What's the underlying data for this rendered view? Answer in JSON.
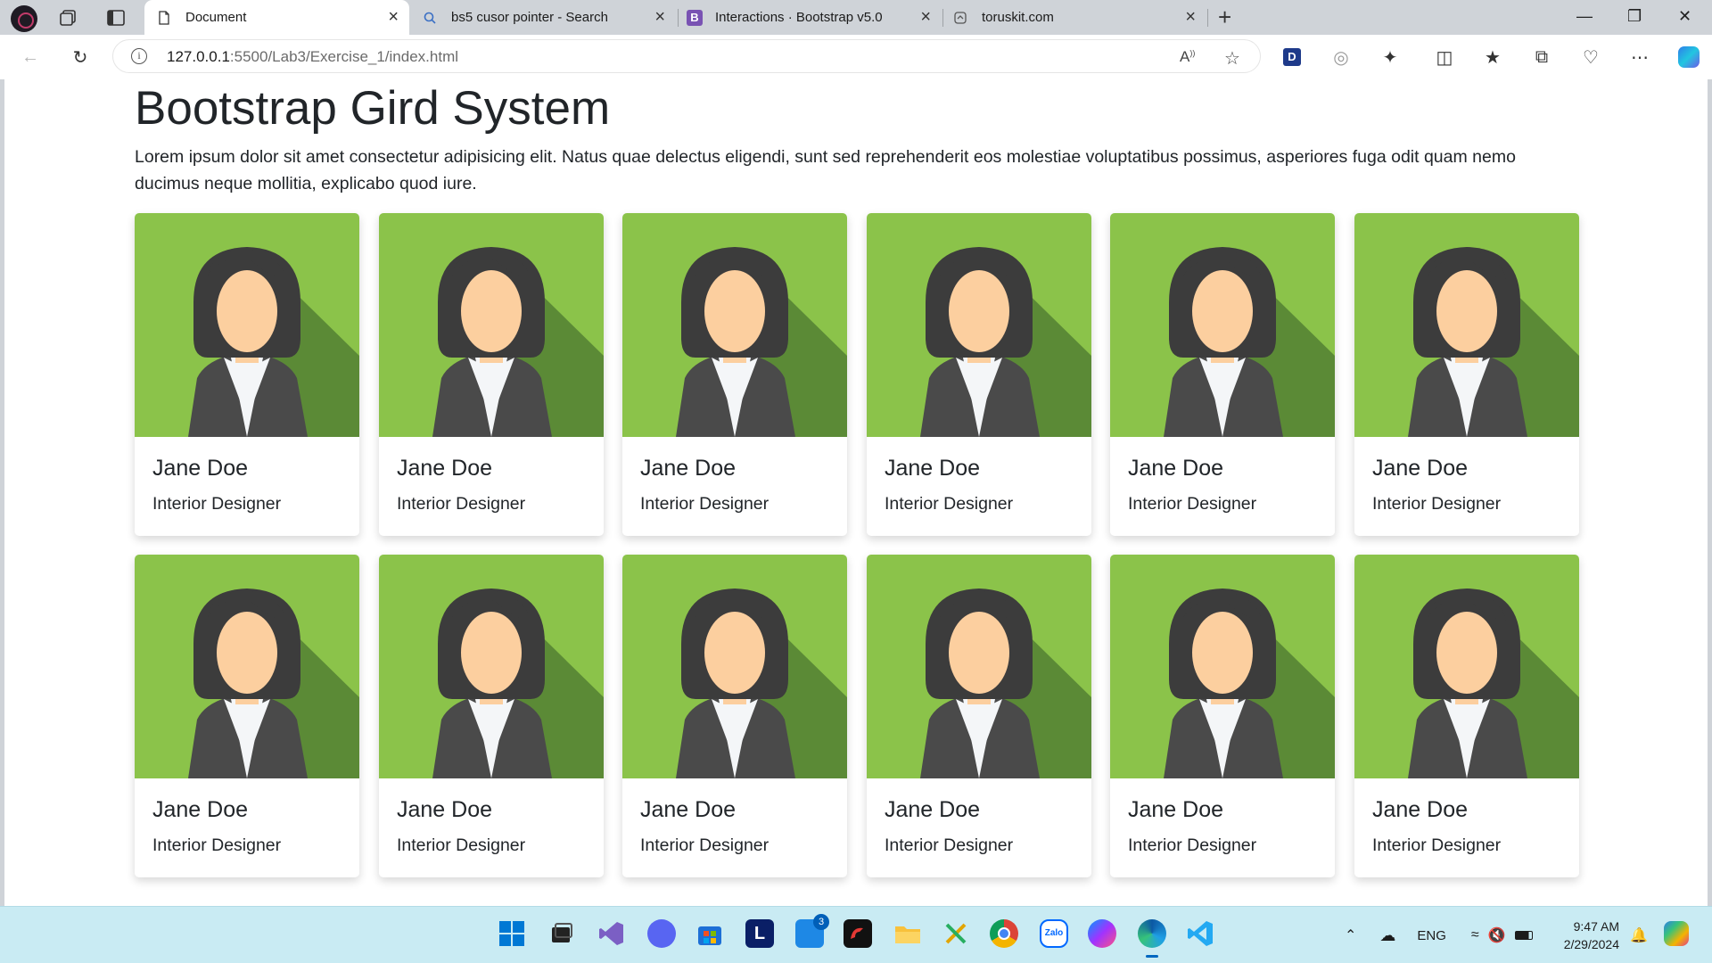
{
  "browser": {
    "tabs": [
      {
        "title": "Document",
        "favicon": "document-icon",
        "active": true
      },
      {
        "title": "bs5 cusor pointer - Search",
        "favicon": "search-icon",
        "active": false
      },
      {
        "title": "Interactions · Bootstrap v5.0",
        "favicon": "bootstrap-icon",
        "active": false
      },
      {
        "title": "toruskit.com",
        "favicon": "globe-icon",
        "active": false
      }
    ],
    "address": {
      "host": "127.0.0.1",
      "path": ":5500/Lab3/Exercise_1/index.html"
    }
  },
  "page": {
    "title": "Bootstrap Gird System",
    "lead": "Lorem ipsum dolor sit amet consectetur adipisicing elit. Natus quae delectus eligendi, sunt sed reprehenderit eos molestiae voluptatibus possimus, asperiores fuga odit quam nemo ducimus neque mollitia, explicabo quod iure.",
    "cards": [
      {
        "name": "Jane Doe",
        "role": "Interior Designer"
      },
      {
        "name": "Jane Doe",
        "role": "Interior Designer"
      },
      {
        "name": "Jane Doe",
        "role": "Interior Designer"
      },
      {
        "name": "Jane Doe",
        "role": "Interior Designer"
      },
      {
        "name": "Jane Doe",
        "role": "Interior Designer"
      },
      {
        "name": "Jane Doe",
        "role": "Interior Designer"
      },
      {
        "name": "Jane Doe",
        "role": "Interior Designer"
      },
      {
        "name": "Jane Doe",
        "role": "Interior Designer"
      },
      {
        "name": "Jane Doe",
        "role": "Interior Designer"
      },
      {
        "name": "Jane Doe",
        "role": "Interior Designer"
      },
      {
        "name": "Jane Doe",
        "role": "Interior Designer"
      },
      {
        "name": "Jane Doe",
        "role": "Interior Designer"
      }
    ],
    "colors": {
      "avatar_bg": "#8bc34a",
      "avatar_shadow": "#5b8a36",
      "skin": "#fccf9f",
      "hair": "#3c3c3c",
      "jacket": "#4a4a4a"
    }
  },
  "taskbar": {
    "apps": [
      "start-icon",
      "taskview-icon",
      "visual-studio-icon",
      "discord-icon",
      "store-icon",
      "l-app-icon",
      "teams-icon",
      "garena-icon",
      "file-explorer-icon",
      "snipping-icon",
      "chrome-icon",
      "zalo-icon",
      "messenger-icon",
      "edge-icon",
      "vscode-icon"
    ],
    "teams_badge": "3",
    "language": "ENG",
    "time": "9:47 AM",
    "date": "2/29/2024"
  }
}
